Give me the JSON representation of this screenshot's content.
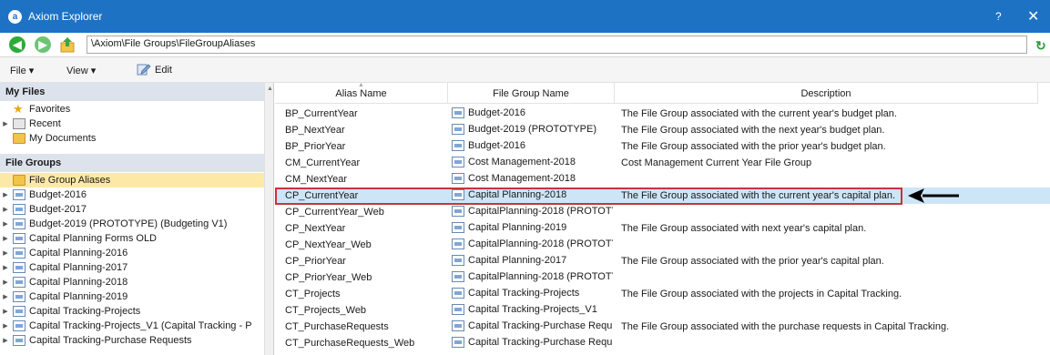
{
  "window": {
    "title": "Axiom Explorer",
    "help": "?",
    "close": "✕"
  },
  "address": {
    "path": "\\Axiom\\File Groups\\FileGroupAliases",
    "back": "◀",
    "forward": "▶",
    "refresh": "↻"
  },
  "menu": {
    "file": "File ▾",
    "view": "View ▾",
    "edit": "Edit"
  },
  "left": {
    "my_files_header": "My Files",
    "my_files": [
      {
        "label": "Favorites",
        "icon": "star-icon"
      },
      {
        "label": "Recent",
        "icon": "recent-icon",
        "expandable": true
      },
      {
        "label": "My Documents",
        "icon": "folder-icon"
      }
    ],
    "file_groups_header": "File Groups",
    "file_groups": [
      {
        "label": "File Group Aliases",
        "icon": "folder-icon",
        "selected": true
      },
      {
        "label": "Budget-2016",
        "icon": "file-group-icon",
        "expandable": true
      },
      {
        "label": "Budget-2017",
        "icon": "file-group-icon",
        "expandable": true
      },
      {
        "label": "Budget-2019 (PROTOTYPE) (Budgeting V1)",
        "icon": "file-group-icon",
        "expandable": true
      },
      {
        "label": "Capital Planning Forms OLD",
        "icon": "file-group-icon",
        "expandable": true
      },
      {
        "label": "Capital Planning-2016",
        "icon": "file-group-icon",
        "expandable": true
      },
      {
        "label": "Capital Planning-2017",
        "icon": "file-group-icon",
        "expandable": true
      },
      {
        "label": "Capital Planning-2018",
        "icon": "file-group-icon",
        "expandable": true
      },
      {
        "label": "Capital Planning-2019",
        "icon": "file-group-icon",
        "expandable": true
      },
      {
        "label": "Capital Tracking-Projects",
        "icon": "file-group-icon",
        "expandable": true
      },
      {
        "label": "Capital Tracking-Projects_V1 (Capital Tracking - P",
        "icon": "file-group-icon",
        "expandable": true
      },
      {
        "label": "Capital Tracking-Purchase Requests",
        "icon": "file-group-icon",
        "expandable": true
      }
    ]
  },
  "grid": {
    "columns": [
      "Alias Name",
      "File Group Name",
      "Description"
    ],
    "rows": [
      {
        "alias": "BP_CurrentYear",
        "group": "Budget-2016",
        "description": "The File Group associated with the current year's budget plan."
      },
      {
        "alias": "BP_NextYear",
        "group": "Budget-2019 (PROTOTYPE)",
        "description": "The File Group associated with the next year's budget plan."
      },
      {
        "alias": "BP_PriorYear",
        "group": "Budget-2016",
        "description": "The File Group associated with the prior year's budget plan."
      },
      {
        "alias": "CM_CurrentYear",
        "group": "Cost Management-2018",
        "description": "Cost Management Current Year File Group"
      },
      {
        "alias": "CM_NextYear",
        "group": "Cost Management-2018",
        "description": ""
      },
      {
        "alias": "CP_CurrentYear",
        "group": "Capital Planning-2018",
        "description": "The File Group associated with the current year's capital plan.",
        "selected": true
      },
      {
        "alias": "CP_CurrentYear_Web",
        "group": "CapitalPlanning-2018 (PROTOTY",
        "description": ""
      },
      {
        "alias": "CP_NextYear",
        "group": "Capital Planning-2019",
        "description": "The File Group associated with next year's capital plan."
      },
      {
        "alias": "CP_NextYear_Web",
        "group": "CapitalPlanning-2018 (PROTOTY",
        "description": ""
      },
      {
        "alias": "CP_PriorYear",
        "group": "Capital Planning-2017",
        "description": "The File Group associated with the prior year's capital plan."
      },
      {
        "alias": "CP_PriorYear_Web",
        "group": "CapitalPlanning-2018 (PROTOTY",
        "description": ""
      },
      {
        "alias": "CT_Projects",
        "group": "Capital Tracking-Projects",
        "description": "The File Group associated with the projects in Capital Tracking."
      },
      {
        "alias": "CT_Projects_Web",
        "group": "Capital Tracking-Projects_V1",
        "description": ""
      },
      {
        "alias": "CT_PurchaseRequests",
        "group": "Capital Tracking-Purchase Requ",
        "description": "The File Group associated with the purchase requests in Capital Tracking."
      },
      {
        "alias": "CT_PurchaseRequests_Web",
        "group": "Capital Tracking-Purchase Requ",
        "description": ""
      }
    ]
  },
  "colors": {
    "titlebar": "#1d72c4",
    "selection": "#cde6f7",
    "tree_selection": "#fde9a6",
    "highlight": "#c9323d"
  }
}
